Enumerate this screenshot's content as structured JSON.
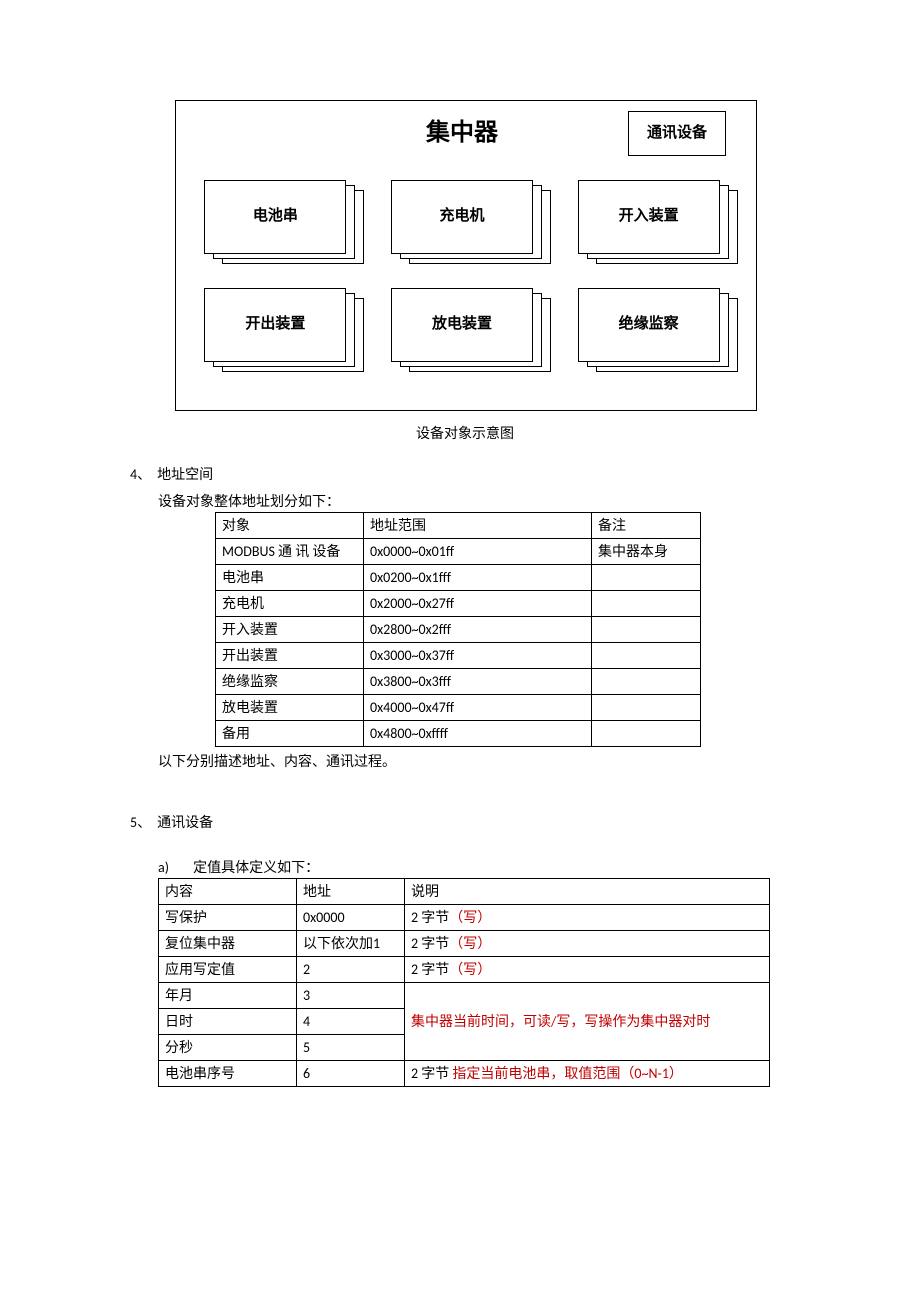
{
  "diagram": {
    "title": "集中器",
    "comm_box": "通讯设备",
    "row1": [
      "电池串",
      "充电机",
      "开入装置"
    ],
    "row2": [
      "开出装置",
      "放电装置",
      "绝缘监察"
    ],
    "caption": "设备对象示意图"
  },
  "section4": {
    "num": "4、",
    "title": "地址空间",
    "intro": "设备对象整体地址划分如下：",
    "headers": [
      "对象",
      "地址范围",
      "备注"
    ],
    "rows": [
      [
        "MODBUS 通 讯 设备",
        "0x0000~0x01ff",
        "集中器本身"
      ],
      [
        "电池串",
        "0x0200~0x1fff",
        ""
      ],
      [
        "充电机",
        "0x2000~0x27ff",
        ""
      ],
      [
        "开入装置",
        "0x2800~0x2fff",
        ""
      ],
      [
        "开出装置",
        "0x3000~0x37ff",
        ""
      ],
      [
        "绝缘监察",
        "0x3800~0x3fff",
        ""
      ],
      [
        "放电装置",
        "0x4000~0x47ff",
        ""
      ],
      [
        "备用",
        "0x4800~0xffff",
        ""
      ]
    ],
    "after": "以下分别描述地址、内容、通讯过程。"
  },
  "section5": {
    "num": "5、",
    "title": "通讯设备",
    "sub_a": "a)",
    "sub_a_title": "定值具体定义如下：",
    "headers": [
      "内容",
      "地址",
      "说明"
    ],
    "rows": {
      "r0": {
        "c0": "写保护",
        "c1": "0x0000",
        "c2_prefix": "2 字节",
        "c2_red": "（写）"
      },
      "r1": {
        "c0": "复位集中器",
        "c1": "以下依次加1",
        "c2_prefix": "2 字节",
        "c2_red": "（写）"
      },
      "r2": {
        "c0": "应用写定值",
        "c1": "2",
        "c2_prefix": "2 字节",
        "c2_red": "（写）"
      },
      "r3": {
        "c0": "年月",
        "c1": "3"
      },
      "r4": {
        "c0": "日时",
        "c1": "4",
        "c2_merged": "集中器当前时间，可读/写，写操作为集中器对时"
      },
      "r5": {
        "c0": "分秒",
        "c1": "5"
      },
      "r6": {
        "c0": "电池串序号",
        "c1": "6",
        "c2_prefix": "2 字节",
        "c2_red": "   指定当前电池串，取值范围（0~N-1）"
      }
    }
  }
}
